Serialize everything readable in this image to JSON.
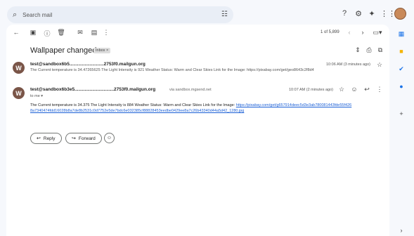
{
  "search": {
    "placeholder": "Search mail",
    "icon": "search-icon",
    "tune_icon": "tune-icon"
  },
  "topbar": {
    "help_icon": "help-icon",
    "settings_icon": "settings-icon",
    "gemini_icon": "sparkle-icon",
    "apps_icon": "apps-grid-icon"
  },
  "toolbar": {
    "pager": "1 of 5,899"
  },
  "thread": {
    "subject": "Wallpaper changed",
    "label": "Inbox ×",
    "messages": [
      {
        "avatar_letter": "W",
        "from": "test@sandbox6b5...........................2753f0.mailgun.org",
        "snippet": "The Current temperature is 34.47265625 The Light Intensity is 921 Weather Status: Warm and Clear Skies Link for the Image: https://pixabay.com/get/geo8643c2f8d4",
        "time": "10:06 AM (3 minutes ago)"
      },
      {
        "avatar_letter": "W",
        "from": "test@sandbox6b3e5...............................2753f0.mailgun.org",
        "via": "via sandbox.mgsend.net",
        "to": "to me ▾",
        "time": "10:07 AM (2 minutes ago)",
        "body_text": "The Current temperature is 34.375 The Light Intensity is 884 Weather Status: Warm and Clear Skies Link for the Image: ",
        "body_link": "https://pixabay.com/get/g657914deec5d3e3ab780081443fde55f426 8a7340474fdd16028b8a7de8b2531c0d7752e5de7bdc6e032385cf88828453eedbe0429ee8a7c26b43340d44a5d42_1280.jpg"
      }
    ]
  },
  "actions": {
    "reply": "Reply",
    "forward": "Forward"
  }
}
